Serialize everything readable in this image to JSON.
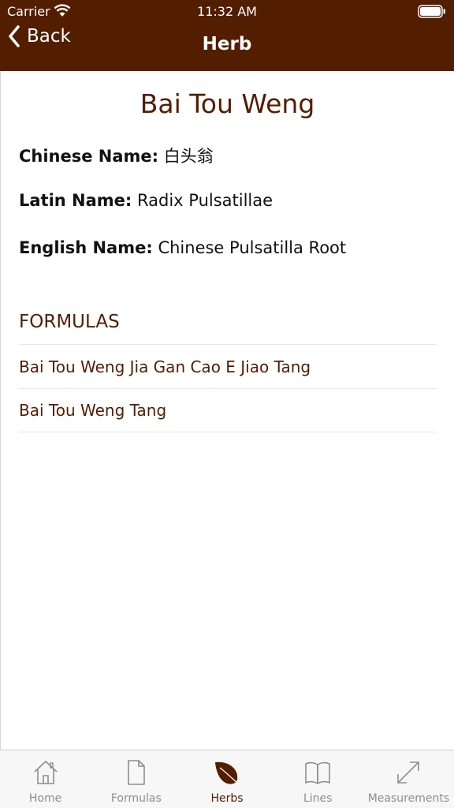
{
  "status_bar": {
    "carrier": "Carrier",
    "time": "11:32 AM"
  },
  "nav": {
    "back_label": "Back",
    "title": "Herb"
  },
  "herb": {
    "name": "Bai Tou Weng",
    "fields": [
      {
        "label": "Chinese Name:",
        "value": "白头翁"
      },
      {
        "label": "Latin Name:",
        "value": "Radix Pulsatillae"
      },
      {
        "label": "English Name:",
        "value": "Chinese Pulsatilla Root"
      }
    ]
  },
  "formulas": {
    "header": "FORMULAS",
    "items": [
      "Bai Tou Weng Jia Gan Cao E Jiao Tang",
      "Bai Tou Weng Tang"
    ]
  },
  "tabs": [
    {
      "label": "Home",
      "icon": "home-icon",
      "active": false
    },
    {
      "label": "Formulas",
      "icon": "document-icon",
      "active": false
    },
    {
      "label": "Herbs",
      "icon": "leaf-icon",
      "active": true
    },
    {
      "label": "Lines",
      "icon": "book-icon",
      "active": false
    },
    {
      "label": "Measurements",
      "icon": "resize-arrow-icon",
      "active": false
    }
  ],
  "colors": {
    "brand": "#531d00",
    "tab_inactive": "#8e8e8e"
  }
}
